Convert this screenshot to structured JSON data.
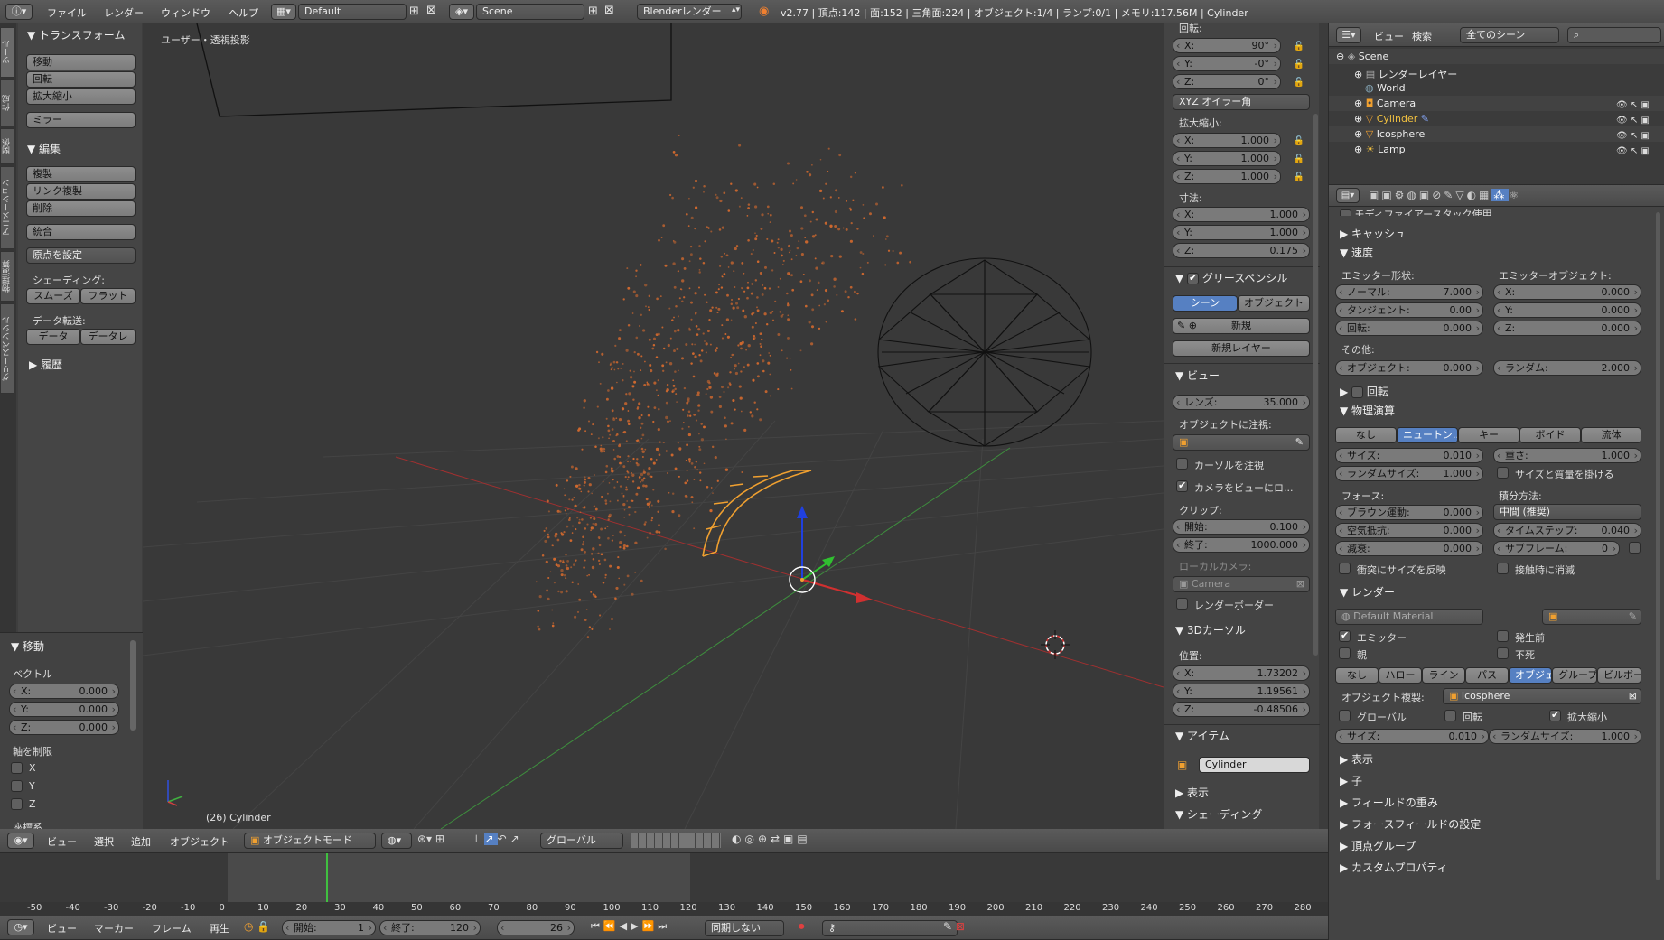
{
  "info_header": {
    "menus": [
      "ファイル",
      "レンダー",
      "ウィンドウ",
      "ヘルプ"
    ],
    "layout": "Default",
    "scene": "Scene",
    "engine": "Blenderレンダー",
    "stats": "v2.77 | 頂点:142 | 面:152 | 三角面:224 | オブジェクト:1/4 | ランプ:0/1 | メモリ:117.56M | Cylinder"
  },
  "tool_shelf": {
    "tabs": [
      "ツール",
      "作成",
      "関係",
      "アニメーション",
      "物理演算",
      "グリースペンシル"
    ],
    "transform_title": "トランスフォーム",
    "move": "移動",
    "rotate": "回転",
    "scale": "拡大縮小",
    "mirror": "ミラー",
    "edit_title": "編集",
    "duplicate": "複製",
    "link_dup": "リンク複製",
    "delete": "削除",
    "join": "統合",
    "set_origin": "原点を設定",
    "shading_label": "シェーディング:",
    "smooth": "スムーズ",
    "flat": "フラット",
    "data_transfer_label": "データ転送:",
    "data": "データ",
    "data_layout": "データレ",
    "history": "履歴"
  },
  "operator_panel": {
    "title": "移動",
    "vector_label": "ベクトル",
    "x": "X:",
    "xv": "0.000",
    "y": "Y:",
    "yv": "0.000",
    "z": "Z:",
    "zv": "0.000",
    "constraint_label": "軸を制限",
    "cx": "X",
    "cy": "Y",
    "cz": "Z",
    "orientation_label": "座標系"
  },
  "viewport": {
    "view_label": "ユーザー・透視投影",
    "object_label": "(26) Cylinder"
  },
  "view3d_header": {
    "view": "ビュー",
    "select": "選択",
    "add": "追加",
    "object": "オブジェクト",
    "mode": "オブジェクトモード",
    "orientation": "グローバル"
  },
  "properties_n": {
    "rotation_label": "回転:",
    "rx": "X:",
    "rxv": "90°",
    "ry": "Y:",
    "ryv": "-0°",
    "rz": "Z:",
    "rzv": "0°",
    "rot_mode": "XYZ オイラー角",
    "scale_label": "拡大縮小:",
    "sx": "X:",
    "sxv": "1.000",
    "sy": "Y:",
    "syv": "1.000",
    "sz": "Z:",
    "szv": "1.000",
    "dim_label": "寸法:",
    "dx": "X:",
    "dxv": "1.000",
    "dy": "Y:",
    "dyv": "1.000",
    "dz": "Z:",
    "dzv": "0.175",
    "grease_title": "グリースペンシル",
    "gp_scene": "シーン",
    "gp_object": "オブジェクト",
    "gp_new": "新規",
    "gp_new_layer": "新規レイヤー",
    "view_title": "ビュー",
    "lens": "レンズ:",
    "lens_v": "35.000",
    "lock_obj": "オブジェクトに注視:",
    "lock_cursor": "カーソルを注視",
    "lock_camera": "カメラをビューにロ...",
    "clip": "クリップ:",
    "clip_start": "開始:",
    "clip_start_v": "0.100",
    "clip_end": "終了:",
    "clip_end_v": "1000.000",
    "local_cam": "ローカルカメラ:",
    "camera": "Camera",
    "render_border": "レンダーボーダー",
    "cursor_title": "3Dカーソル",
    "location": "位置:",
    "cx": "X:",
    "cxv": "1.73202",
    "cy": "Y:",
    "cyv": "1.19561",
    "cz": "Z:",
    "czv": "-0.48506",
    "item_title": "アイテム",
    "item_name": "Cylinder",
    "display_title": "表示",
    "shading_title": "シェーディング"
  },
  "outliner": {
    "view": "ビュー",
    "search": "検索",
    "filter": "全てのシーン",
    "items": [
      "Scene",
      "レンダーレイヤー",
      "World",
      "Camera",
      "Cylinder",
      "Icosphere",
      "Lamp"
    ]
  },
  "particles": {
    "modifier_stack": "モディファイアースタック使用",
    "cache": "キャッシュ",
    "velocity": "速度",
    "emitter_shape": "エミッター形状:",
    "normal": "ノーマル:",
    "normal_v": "7.000",
    "tangent": "タンジェント:",
    "tangent_v": "0.00",
    "rotation_sm": "回転:",
    "rotation_sm_v": "0.000",
    "emitter_obj": "エミッターオブジェクト:",
    "ex": "X:",
    "exv": "0.000",
    "ey": "Y:",
    "eyv": "0.000",
    "ez": "Z:",
    "ezv": "0.000",
    "other": "その他:",
    "object": "オブジェクト:",
    "object_v": "0.000",
    "random": "ランダム:",
    "random_v": "2.000",
    "rotation": "回転",
    "physics": "物理演算",
    "phys_types": [
      "なし",
      "ニュートン...",
      "キー",
      "ボイド",
      "流体"
    ],
    "size": "サイズ:",
    "size_v": "0.010",
    "mass": "重さ:",
    "mass_v": "1.000",
    "rand_size": "ランダムサイズ:",
    "rand_size_v": "1.000",
    "mult_mass": "サイズと質量を掛ける",
    "forces": "フォース:",
    "integration": "積分方法:",
    "brownian": "ブラウン運動:",
    "brownian_v": "0.000",
    "integ_method": "中間 (推奨)",
    "drag": "空気抵抗:",
    "drag_v": "0.000",
    "timestep": "タイムステップ:",
    "timestep_v": "0.040",
    "damp": "減衰:",
    "damp_v": "0.000",
    "subframes": "サブフレーム:",
    "subframes_v": "0",
    "size_deflect": "衝突にサイズを反映",
    "die_on_hit": "接触時に消滅",
    "render": "レンダー",
    "material": "Default Material",
    "emitter": "エミッター",
    "parents": "親",
    "unborn": "発生前",
    "died": "不死",
    "render_types": [
      "なし",
      "ハロー",
      "ライン",
      "パス",
      "オブジェ",
      "グループ",
      "ビルボー"
    ],
    "dupli_obj": "オブジェクト複製:",
    "dupli_name": "Icosphere",
    "global": "グローバル",
    "rot": "回転",
    "scale": "拡大縮小",
    "r_size": "サイズ:",
    "r_size_v": "0.010",
    "r_rand_size": "ランダムサイズ:",
    "r_rand_size_v": "1.000",
    "display": "表示",
    "children": "子",
    "field_weights": "フィールドの重み",
    "force_field": "フォースフィールドの設定",
    "vertex_groups": "頂点グループ",
    "custom_props": "カスタムプロパティ"
  },
  "timeline": {
    "ticks": [
      "-50",
      "-40",
      "-30",
      "-20",
      "-10",
      "0",
      "10",
      "20",
      "30",
      "40",
      "50",
      "60",
      "70",
      "80",
      "90",
      "100",
      "110",
      "120",
      "130",
      "140",
      "150",
      "160",
      "170",
      "180",
      "190",
      "200",
      "210",
      "220",
      "230",
      "240",
      "250",
      "260",
      "270",
      "280"
    ],
    "view": "ビュー",
    "marker": "マーカー",
    "frame": "フレーム",
    "playback": "再生",
    "start": "開始:",
    "start_v": "1",
    "end": "終了:",
    "end_v": "120",
    "current": "26",
    "sync": "同期しない"
  },
  "colors": {
    "accent": "#5680c2",
    "selected_object": "#f0a030",
    "particles": "#d2692e",
    "x_axis": "#c03030",
    "y_axis": "#40a040"
  }
}
